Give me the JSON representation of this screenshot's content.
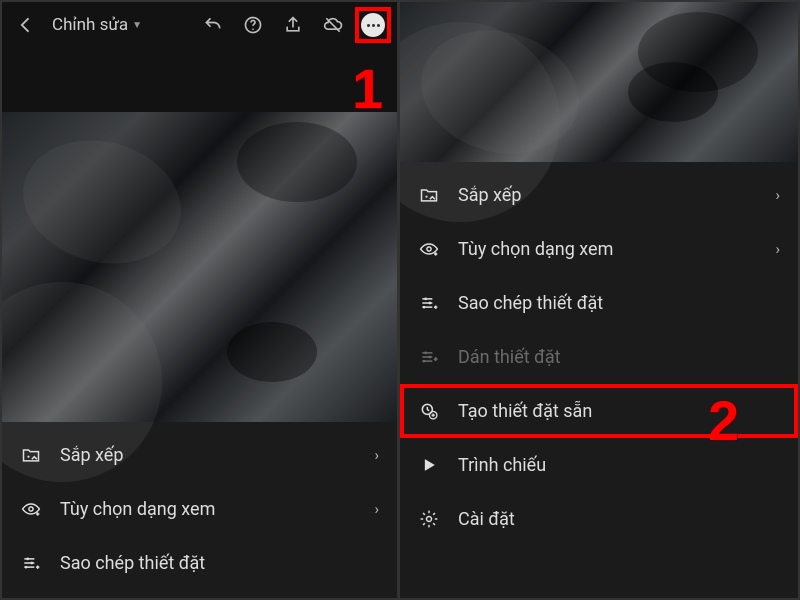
{
  "annotations": {
    "step1": "1",
    "step2": "2"
  },
  "left": {
    "title": "Chỉnh sửa",
    "menu": [
      {
        "key": "organize",
        "label": "Sắp xếp",
        "chevron": true,
        "icon": "folder-image-icon"
      },
      {
        "key": "viewopts",
        "label": "Tùy chọn dạng xem",
        "chevron": true,
        "icon": "eye-plus-icon"
      },
      {
        "key": "copyset",
        "label": "Sao chép thiết đặt",
        "chevron": false,
        "icon": "sliders-copy-icon"
      }
    ]
  },
  "right": {
    "menu": [
      {
        "key": "organize",
        "label": "Sắp xếp",
        "chevron": true,
        "icon": "folder-image-icon"
      },
      {
        "key": "viewopts",
        "label": "Tùy chọn dạng xem",
        "chevron": true,
        "icon": "eye-plus-icon"
      },
      {
        "key": "copyset",
        "label": "Sao chép thiết đặt",
        "chevron": false,
        "icon": "sliders-copy-icon"
      },
      {
        "key": "pasteset",
        "label": "Dán thiết đặt",
        "chevron": false,
        "icon": "sliders-paste-icon",
        "disabled": true
      },
      {
        "key": "makepreset",
        "label": "Tạo thiết đặt sẵn",
        "chevron": false,
        "icon": "preset-add-icon",
        "highlight": true
      },
      {
        "key": "slideshow",
        "label": "Trình chiếu",
        "chevron": false,
        "icon": "play-icon"
      },
      {
        "key": "settings",
        "label": "Cài đặt",
        "chevron": false,
        "icon": "gear-icon"
      }
    ]
  }
}
